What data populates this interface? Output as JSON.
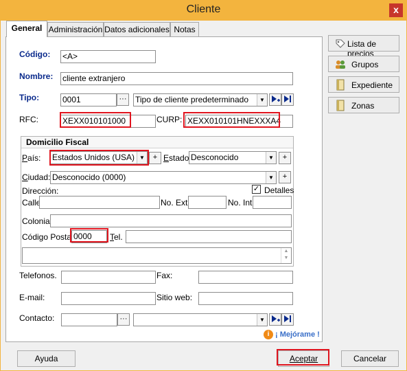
{
  "window": {
    "title": "Cliente",
    "close": "x"
  },
  "tabs": [
    "General",
    "Administración",
    "Datos adicionales",
    "Notas"
  ],
  "fields": {
    "codigo_label": "Código:",
    "codigo_value": "<A>",
    "nombre_label": "Nombre:",
    "nombre_value": "cliente extranjero",
    "tipo_label": "Tipo:",
    "tipo_code": "0001",
    "tipo_desc": "Tipo de cliente predeterminado",
    "rfc_label": "RFC:",
    "rfc_value": "XEXX010101000",
    "curp_label": "CURP:",
    "curp_value": "XEXX010101HNEXXXA4"
  },
  "domicilio": {
    "title": "Domicilio Fiscal",
    "pais_label": "País:",
    "pais_value": "Estados Unidos (USA)",
    "estado_label": "Estado:",
    "estado_value": "Desconocido",
    "ciudad_label": "Ciudad:",
    "ciudad_value": "Desconocido (0000)",
    "direccion_label": "Dirección:",
    "detalles_label": "Detalles",
    "detalles_checked": true,
    "calle_label": "Calle",
    "noext_label": "No. Ext.",
    "noint_label": "No. Int.",
    "colonia_label": "Colonia:",
    "cp_label": "Código Postal:",
    "cp_value": "0000",
    "tel_label": "Tel."
  },
  "contact": {
    "telefonos_label": "Telefonos.",
    "fax_label": "Fax:",
    "email_label": "E-mail:",
    "sitio_label": "Sitio web:",
    "contacto_label": "Contacto:"
  },
  "side_buttons": [
    "Lista de precios",
    "Grupos",
    "Expediente",
    "Zonas"
  ],
  "improve_link": "¡ Mejórame !",
  "footer": {
    "ayuda": "Ayuda",
    "aceptar": "Aceptar",
    "cancelar": "Cancelar"
  },
  "colors": {
    "title_bar": "#f3b43e",
    "highlight": "#e0141e",
    "label_blue": "#0a2a8c"
  }
}
